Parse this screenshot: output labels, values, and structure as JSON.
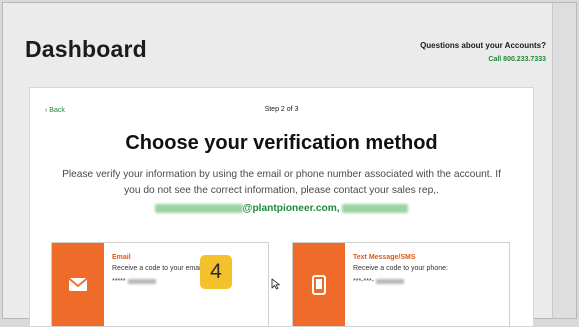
{
  "page": {
    "title": "Dashboard",
    "help_question": "Questions about your Accounts?",
    "help_phone": "Call 800.233.7333"
  },
  "card": {
    "back_label": "‹ Back",
    "step_label": "Step 2 of 3",
    "heading": "Choose your verification method",
    "description_line1": "Please verify your information by using the email or phone number associated with the account. If",
    "description_line2": "you do not see the correct information, please contact your sales rep,.",
    "email_domain": "@plantpioneer.com,",
    "options": [
      {
        "title": "Email",
        "subtitle": "Receive a code to your email:",
        "masked_value": "*****",
        "icon": "envelope-icon"
      },
      {
        "title": "Text Message/SMS",
        "subtitle": "Receive a code to your phone:",
        "masked_value": "***-***-",
        "icon": "mobile-phone-icon"
      }
    ]
  },
  "annotation": {
    "step_badge": "4"
  },
  "colors": {
    "accent_orange": "#ef6b2a",
    "accent_green": "#1f8a3a",
    "badge_yellow": "#f3c12b"
  }
}
